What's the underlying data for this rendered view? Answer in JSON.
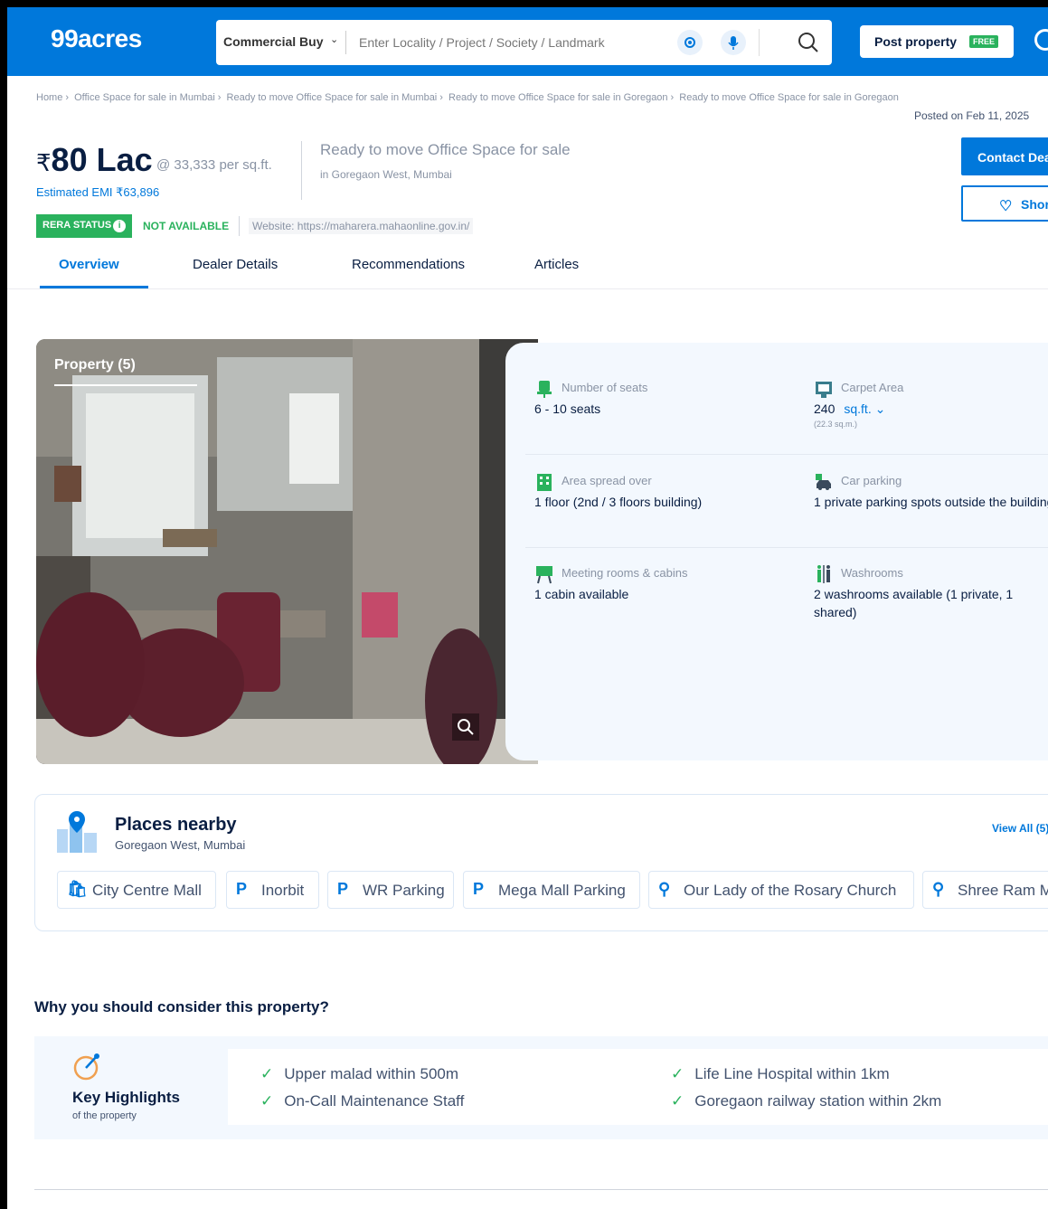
{
  "header": {
    "logo": "99acres",
    "category": "Commercial Buy",
    "search_placeholder": "Enter Locality / Project / Society / Landmark",
    "post_property": "Post property",
    "free_badge": "FREE"
  },
  "breadcrumb": {
    "items": [
      "Home",
      "Office Space for sale in Mumbai",
      "Ready to move Office Space for sale in Mumbai",
      "Ready to move Office Space for sale in Goregaon",
      "Ready to move Office Space for sale in Goregaon"
    ],
    "posted": "Posted on Feb 11, 2025"
  },
  "summary": {
    "currency": "₹",
    "price": "80 Lac",
    "per_sqft": "@ 33,333 per sq.ft.",
    "emi": "Estimated EMI ₹63,896",
    "title": "Ready to move Office Space for sale",
    "location": "in Goregaon West, Mumbai",
    "rera_label": "RERA STATUS",
    "rera_value": "NOT AVAILABLE",
    "website": "Website: https://maharera.mahaonline.gov.in/",
    "contact_button": "Contact Dealer",
    "shortlist_button": "Shortlist"
  },
  "tabs": [
    "Overview",
    "Dealer Details",
    "Recommendations",
    "Articles"
  ],
  "property": {
    "photo_label": "Property (5)",
    "details": [
      {
        "key": "Number of seats",
        "value": "6 - 10 seats",
        "icon": "seat-icon"
      },
      {
        "key": "Carpet Area",
        "value": "240",
        "unit": "sq.ft.",
        "sub": "(22.3 sq.m.)",
        "icon": "carpet-area-icon"
      },
      {
        "key": "Area spread over",
        "value": "1 floor (2nd / 3 floors building)",
        "icon": "building-icon"
      },
      {
        "key": "Car parking",
        "value": "1 private parking spots outside the building",
        "icon": "car-icon"
      },
      {
        "key": "Meeting rooms & cabins",
        "value": "1 cabin available",
        "icon": "meeting-icon"
      },
      {
        "key": "Washrooms",
        "value": "2 washrooms available (1 private, 1 shared)",
        "icon": "washroom-icon"
      }
    ]
  },
  "places": {
    "title": "Places nearby",
    "subtitle": "Goregaon West, Mumbai",
    "view_all": "View All (5)",
    "chips": [
      "City Centre Mall",
      "Inorbit",
      "WR Parking",
      "Mega Mall Parking",
      "Our Lady of the Rosary Church",
      "Shree Ram M"
    ]
  },
  "highlights": {
    "heading": "Why you should consider this property?",
    "title": "Key Highlights",
    "subtitle": "of the property",
    "items": [
      "Upper malad within 500m",
      "Life Line Hospital within 1km",
      "On-Call Maintenance Staff",
      "Goregaon railway station within 2km"
    ]
  },
  "colors": {
    "brand": "#0078db",
    "success": "#2ab25d",
    "text": "#091e42"
  }
}
